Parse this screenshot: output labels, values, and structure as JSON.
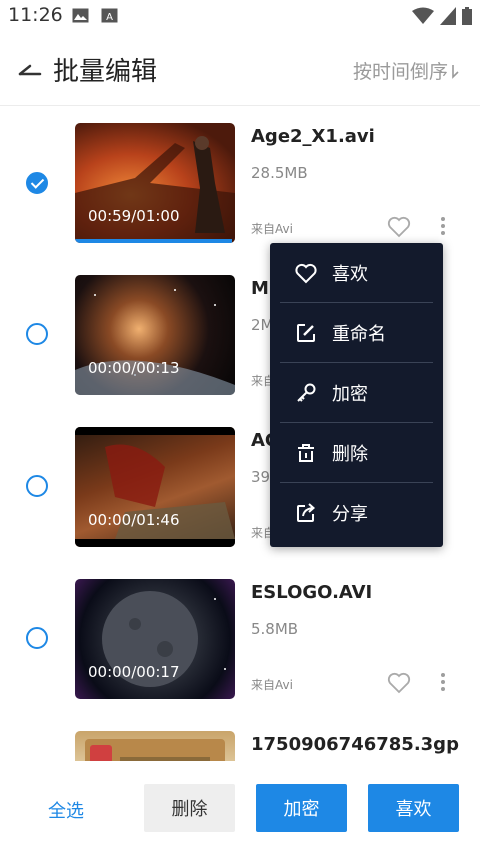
{
  "status_bar": {
    "time": "11:26"
  },
  "header": {
    "title": "批量编辑",
    "sort_label": "按时间倒序"
  },
  "items": [
    {
      "name": "Age2_X1.avi",
      "size": "28.5MB",
      "source": "来自Avi",
      "duration": "00:59/01:00",
      "checked": true,
      "progress": 0.98
    },
    {
      "name": "MS",
      "size": "2M",
      "source": "来自",
      "duration": "00:00/00:13",
      "checked": false
    },
    {
      "name": "AC",
      "size": "39",
      "source": "来自",
      "duration": "00:00/01:46",
      "checked": false
    },
    {
      "name": "ESLOGO.AVI",
      "size": "5.8MB",
      "source": "来自Avi",
      "duration": "00:00/00:17",
      "checked": false
    },
    {
      "name": "1750906746785.3gp",
      "checked": false
    }
  ],
  "context_menu": {
    "items": [
      {
        "label": "喜欢",
        "icon": "heart-icon"
      },
      {
        "label": "重命名",
        "icon": "edit-icon"
      },
      {
        "label": "加密",
        "icon": "key-icon"
      },
      {
        "label": "删除",
        "icon": "trash-icon"
      },
      {
        "label": "分享",
        "icon": "share-icon"
      }
    ]
  },
  "bottom_bar": {
    "select_all": "全选",
    "delete": "删除",
    "encrypt": "加密",
    "like": "喜欢"
  },
  "colors": {
    "accent": "#1e88e5",
    "menu_bg": "#131a2c"
  }
}
